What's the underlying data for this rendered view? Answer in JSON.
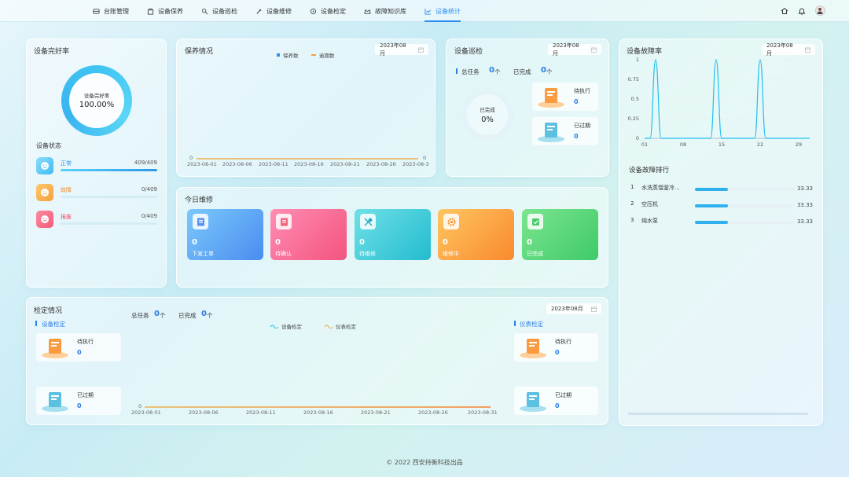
{
  "nav": [
    {
      "label": "台账管理",
      "icon": "ledger-icon"
    },
    {
      "label": "设备保养",
      "icon": "maintenance-icon"
    },
    {
      "label": "设备巡检",
      "icon": "inspection-icon"
    },
    {
      "label": "设备维修",
      "icon": "repair-icon"
    },
    {
      "label": "设备检定",
      "icon": "calibration-icon"
    },
    {
      "label": "故障知识库",
      "icon": "knowledge-icon"
    },
    {
      "label": "设备统计",
      "icon": "statistics-icon",
      "active": true
    }
  ],
  "health": {
    "title": "设备完好率",
    "ring_label": "设备完好率",
    "ring_value": "100.00%",
    "ring_fraction": 1.0,
    "status_title": "设备状态",
    "statuses": [
      {
        "name": "正常",
        "value": "409/409",
        "fraction": 1.0,
        "color": "#3bbcf2",
        "name_color": "#2f8cf0"
      },
      {
        "name": "故障",
        "value": "0/409",
        "fraction": 0,
        "color": "#f6a13c",
        "name_color": "#f38a2a"
      },
      {
        "name": "报废",
        "value": "0/409",
        "fraction": 0,
        "color": "#f45c7a",
        "name_color": "#f04a6a"
      }
    ]
  },
  "upkeep": {
    "title": "保养情况",
    "legend": [
      "保养数",
      "逾期数"
    ],
    "date": "2023年08月",
    "y_left": "0",
    "y_right": "0",
    "x_ticks": [
      "2023-08-01",
      "2023-08-06",
      "2023-08-11",
      "2023-08-16",
      "2023-08-21",
      "2023-08-26",
      "2023-08-3"
    ]
  },
  "patrol": {
    "title": "设备巡检",
    "date": "2023年08月",
    "total_label": "总任务",
    "total_value": "0",
    "total_unit": "个",
    "done_label": "已完成",
    "done_value": "0",
    "done_unit": "个",
    "ring_label": "已完成",
    "ring_value": "0%",
    "pending_label": "待执行",
    "pending_value": "0",
    "overdue_label": "已过期",
    "overdue_value": "0"
  },
  "today_repair": {
    "title": "今日维修",
    "tiles": [
      {
        "label": "下发工单",
        "value": "0",
        "icon": "dispatch-order-icon"
      },
      {
        "label": "待确认",
        "value": "0",
        "icon": "pending-confirm-icon"
      },
      {
        "label": "待维修",
        "value": "0",
        "icon": "tools-icon"
      },
      {
        "label": "维修中",
        "value": "0",
        "icon": "gear-icon"
      },
      {
        "label": "已完成",
        "value": "0",
        "icon": "check-icon"
      }
    ]
  },
  "fault": {
    "title": "设备故障率",
    "date": "2023年08月",
    "rank_title": "设备故障排行",
    "ranks": [
      {
        "idx": "1",
        "name": "水洗蒸馏釜冷...",
        "value": "33.33",
        "fraction": 0.33
      },
      {
        "idx": "2",
        "name": "空压机",
        "value": "33.33",
        "fraction": 0.33
      },
      {
        "idx": "3",
        "name": "纯水泵",
        "value": "33.33",
        "fraction": 0.33
      }
    ]
  },
  "verify": {
    "title": "检定情况",
    "date": "2023年08月",
    "left_section": "设备检定",
    "right_section": "仪表检定",
    "total_label": "总任务",
    "total_value": "0",
    "total_unit": "个",
    "done_label": "已完成",
    "done_value": "0",
    "done_unit": "个",
    "legend": [
      "设备检定",
      "仪表检定"
    ],
    "pending_label": "待执行",
    "pending_value": "0",
    "overdue_label": "已过期",
    "overdue_value": "0",
    "y_left": "0",
    "x_ticks": [
      "2023-08-01",
      "2023-08-06",
      "2023-08-11",
      "2023-08-16",
      "2023-08-21",
      "2023-08-26",
      "2023-08-31"
    ]
  },
  "footer": "© 2022 西安持衡科技出品",
  "chart_data": {
    "type": "line",
    "x": [
      "01",
      "02",
      "03",
      "04",
      "05",
      "06",
      "07",
      "08",
      "09",
      "10",
      "11",
      "12",
      "13",
      "14",
      "15",
      "16",
      "17",
      "18",
      "19",
      "20",
      "21",
      "22",
      "23",
      "24",
      "25",
      "26",
      "27",
      "28",
      "29",
      "30",
      "31"
    ],
    "series": [
      {
        "values": [
          0,
          0,
          1,
          0,
          0,
          0,
          0,
          0,
          0,
          0,
          0,
          0,
          0,
          1,
          0,
          0,
          0,
          0,
          0,
          0,
          0,
          1,
          0,
          0,
          0,
          0,
          0,
          0,
          0,
          0,
          0
        ]
      }
    ],
    "x_tick_labels": [
      "01",
      "08",
      "15",
      "22",
      "29"
    ],
    "y_ticks": [
      "0",
      "0.25",
      "0.5",
      "0.75",
      "1"
    ],
    "ylim": [
      0,
      1
    ],
    "color": "#22bfee"
  }
}
